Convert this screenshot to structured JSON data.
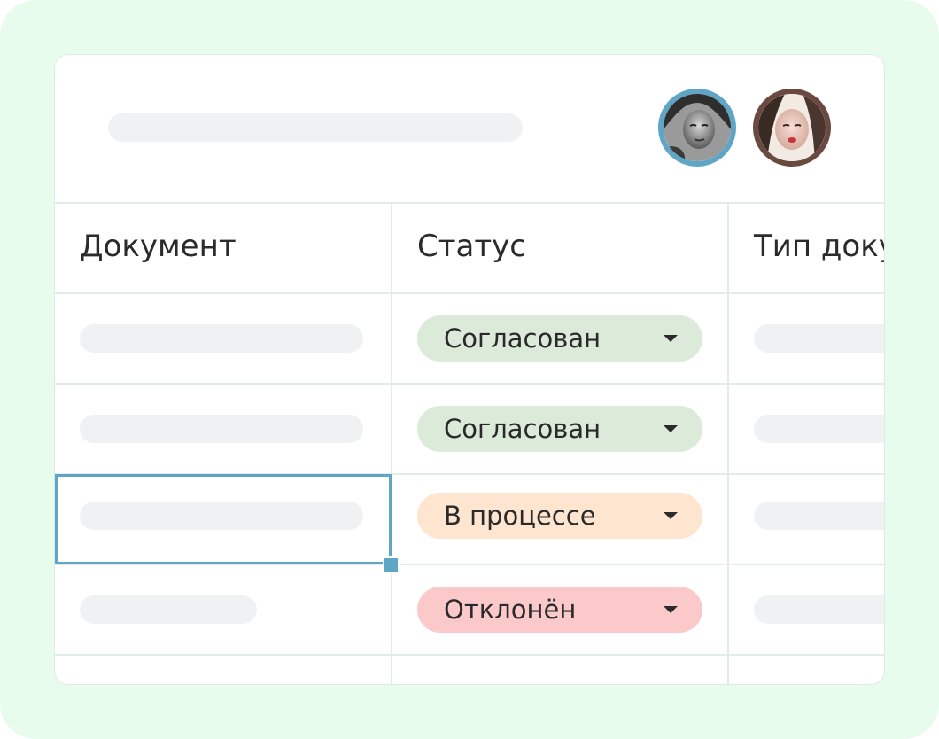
{
  "table": {
    "columns": [
      "Документ",
      "Статус",
      "Тип документа"
    ],
    "visible_header_text": [
      "Документ",
      "Статус",
      "Тип доку"
    ],
    "rows": [
      {
        "status": "Согласован",
        "status_color": "#dcebd9"
      },
      {
        "status": "Согласован",
        "status_color": "#dcebd9"
      },
      {
        "status": "В процессе",
        "status_color": "#fde5cf"
      },
      {
        "status": "Отклонён",
        "status_color": "#fcc9cb"
      }
    ],
    "selected_row_index": 2
  },
  "avatars": [
    {
      "name": "user-avatar-1",
      "ring_color": "#5fa6c6"
    },
    {
      "name": "user-avatar-2",
      "ring_color": "#6a4a40"
    }
  ],
  "colors": {
    "background": "#e8fcee",
    "accent": "#5fa6c6",
    "skeleton": "#f0f1f3",
    "grid": "#e1ece9"
  }
}
